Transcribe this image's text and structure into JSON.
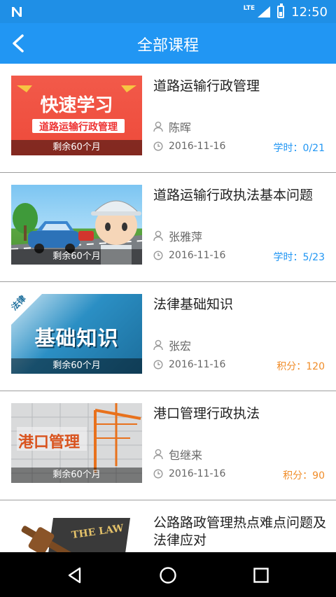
{
  "status_bar": {
    "network": "LTE",
    "time": "12:50"
  },
  "app_bar": {
    "title": "全部课程"
  },
  "courses": [
    {
      "title": "道路运输行政管理",
      "teacher": "陈晖",
      "date": "2016-11-16",
      "stat": "学时：0/21",
      "stat_type": "hours",
      "remaining": "剩余60个月",
      "thumb_text": "快速学习",
      "thumb_sub": "道路运输行政管理"
    },
    {
      "title": "道路运输行政执法基本问题",
      "teacher": "张雅萍",
      "date": "2016-11-16",
      "stat": "学时：5/23",
      "stat_type": "hours",
      "remaining": "剩余60个月"
    },
    {
      "title": "法律基础知识",
      "teacher": "张宏",
      "date": "2016-11-16",
      "stat": "积分：120",
      "stat_type": "points",
      "remaining": "剩余60个月",
      "thumb_text": "基础知识",
      "thumb_corner": "法律"
    },
    {
      "title": "港口管理行政执法",
      "teacher": "包继来",
      "date": "2016-11-16",
      "stat": "积分：90",
      "stat_type": "points",
      "remaining": "剩余60个月",
      "thumb_text": "港口管理"
    },
    {
      "title": "公路路政管理热点难点问题及法律应对",
      "thumb_text": "THE LAW"
    }
  ],
  "colors": {
    "status_bar": "#1f8fe6",
    "app_bar": "#2196f3",
    "hours": "#2196f3",
    "points": "#f08c28"
  }
}
